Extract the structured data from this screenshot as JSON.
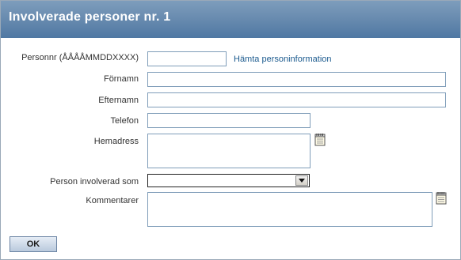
{
  "dialog": {
    "title": "Involverade personer nr. 1"
  },
  "form": {
    "personnr": {
      "label": "Personnr (ÅÅÅÅMMDDXXXX)",
      "value": ""
    },
    "fetch_link": "Hämta personinformation",
    "fornamn": {
      "label": "Förnamn",
      "value": ""
    },
    "efternamn": {
      "label": "Efternamn",
      "value": ""
    },
    "telefon": {
      "label": "Telefon",
      "value": ""
    },
    "hemadress": {
      "label": "Hemadress",
      "value": ""
    },
    "involverad_som": {
      "label": "Person involverad som",
      "selected": ""
    },
    "kommentarer": {
      "label": "Kommentarer",
      "value": ""
    }
  },
  "buttons": {
    "ok_label": "OK"
  },
  "icons": {
    "hemadress_notes": "notepad-icon",
    "kommentarer_notes": "notepad-icon"
  }
}
